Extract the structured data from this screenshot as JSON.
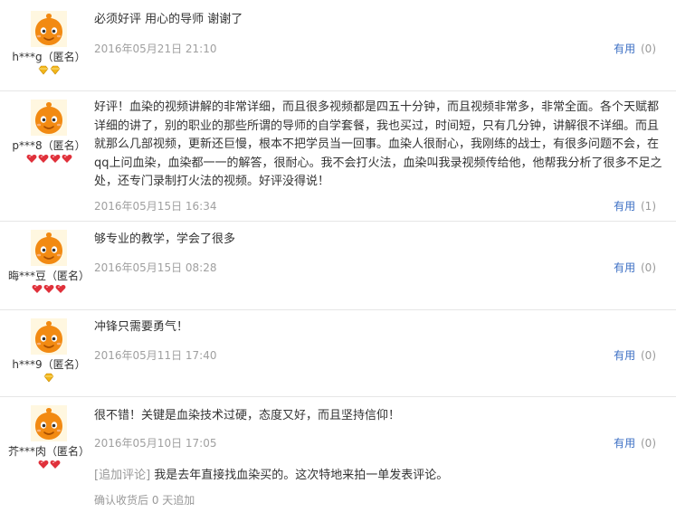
{
  "reviews": [
    {
      "username": "h***g（匿名）",
      "badge": "gold",
      "badge_count": 2,
      "text": "必须好评 用心的导师 谢谢了",
      "date": "2016年05月21日 21:10",
      "helpful_label": "有用",
      "helpful_count": "(0)"
    },
    {
      "username": "p***8（匿名）",
      "badge": "red",
      "badge_count": 4,
      "text": "好评！血染的视频讲解的非常详细，而且很多视频都是四五十分钟，而且视频非常多，非常全面。各个天赋都详细的讲了，别的职业的那些所谓的导师的自学套餐，我也买过，时间短，只有几分钟，讲解很不详细。而且就那么几部视频，更新还巨慢，根本不把学员当一回事。血染人很耐心，我刚练的战士，有很多问题不会，在qq上问血染，血染都一一的解答，很耐心。我不会打火法，血染叫我录视频传给他，他帮我分析了很多不足之处，还专门录制打火法的视频。好评没得说！",
      "date": "2016年05月15日 16:34",
      "helpful_label": "有用",
      "helpful_count": "(1)"
    },
    {
      "username": "晦***豆（匿名）",
      "badge": "red",
      "badge_count": 3,
      "text": "够专业的教学，学会了很多",
      "date": "2016年05月15日 08:28",
      "helpful_label": "有用",
      "helpful_count": "(0)"
    },
    {
      "username": "h***9（匿名）",
      "badge": "gold",
      "badge_count": 1,
      "text": "冲锋只需要勇气！",
      "date": "2016年05月11日 17:40",
      "helpful_label": "有用",
      "helpful_count": "(0)"
    },
    {
      "username": "芥***肉（匿名）",
      "badge": "red",
      "badge_count": 2,
      "text": "很不错！关键是血染技术过硬，态度又好，而且坚持信仰！",
      "date": "2016年05月10日 17:05",
      "helpful_label": "有用",
      "helpful_count": "(0)",
      "followup_tag": "[追加评论]",
      "followup_text": "我是去年直接找血染买的。这次特地来拍一单发表评论。",
      "confirm_text": "确认收货后 0 天追加"
    }
  ],
  "colors": {
    "gold_badge": "#f2b61a",
    "red_badge": "#e0313b",
    "link": "#3c6fc4",
    "avatar_orange": "#f28a12"
  },
  "icons": {
    "avatar": "default-avatar-icon",
    "gold": "gold-diamond-icon",
    "red": "red-heart-icon"
  }
}
